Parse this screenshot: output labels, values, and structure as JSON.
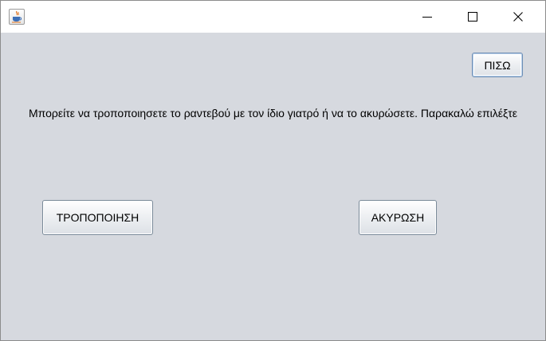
{
  "window": {
    "app_icon": "java-cup-icon",
    "controls": {
      "minimize_icon": "minimize-icon",
      "maximize_icon": "maximize-icon",
      "close_icon": "close-icon"
    }
  },
  "content": {
    "back_button_label": "ΠΙΣΩ",
    "message": "Μπορείτε να τροποποιησετε το ραντεβού με τον ίδιο γιατρό ή να το ακυρώσετε. Παρακαλώ επιλέξτε",
    "modify_button_label": "ΤΡΟΠΟΠΟΙΗΣΗ",
    "cancel_button_label": "ΑΚΥΡΩΣΗ"
  },
  "colors": {
    "content_background": "#d6d9df",
    "titlebar_background": "#ffffff"
  }
}
